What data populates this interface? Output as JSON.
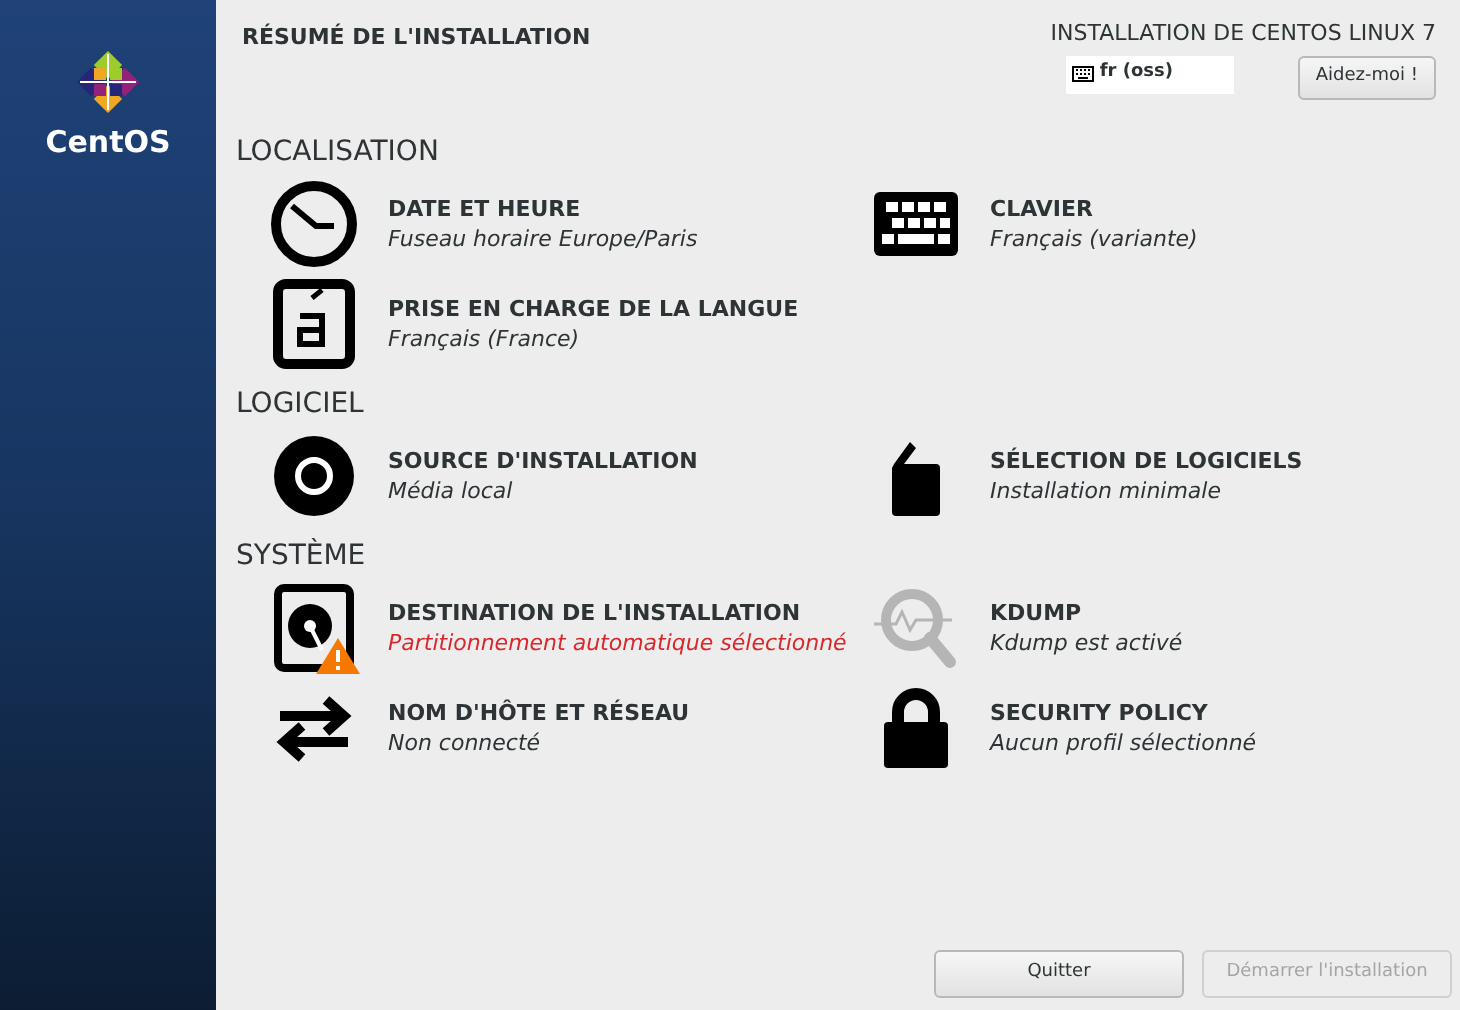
{
  "sidebar": {
    "logo_text": "CentOS"
  },
  "header": {
    "title": "RÉSUMÉ DE L'INSTALLATION",
    "product": "INSTALLATION DE CENTOS LINUX 7",
    "keyboard_layout": "fr (oss)",
    "help_button": "Aidez-moi !"
  },
  "sections": [
    {
      "heading": "LOCALISATION",
      "items": [
        {
          "title": "DATE ET HEURE",
          "status": "Fuseau horaire Europe/Paris",
          "warning": false
        },
        {
          "title": "CLAVIER",
          "status": "Français (variante)",
          "warning": false
        },
        {
          "title": "PRISE EN CHARGE DE LA LANGUE",
          "status": "Français (France)",
          "warning": false
        }
      ]
    },
    {
      "heading": "LOGICIEL",
      "items": [
        {
          "title": "SOURCE D'INSTALLATION",
          "status": "Média local",
          "warning": false
        },
        {
          "title": "SÉLECTION DE LOGICIELS",
          "status": "Installation minimale",
          "warning": false
        }
      ]
    },
    {
      "heading": "SYSTÈME",
      "items": [
        {
          "title": "DESTINATION DE L'INSTALLATION",
          "status": "Partitionnement automatique sélectionné",
          "warning": true
        },
        {
          "title": "KDUMP",
          "status": "Kdump est activé",
          "warning": false
        },
        {
          "title": "NOM D'HÔTE ET RÉSEAU",
          "status": "Non connecté",
          "warning": false
        },
        {
          "title": "SECURITY POLICY",
          "status": "Aucun profil sélectionné",
          "warning": false
        }
      ]
    }
  ],
  "footer": {
    "buttons": [
      {
        "label": "Quitter",
        "disabled": false
      },
      {
        "label": "Démarrer l'installation",
        "disabled": true
      }
    ]
  }
}
